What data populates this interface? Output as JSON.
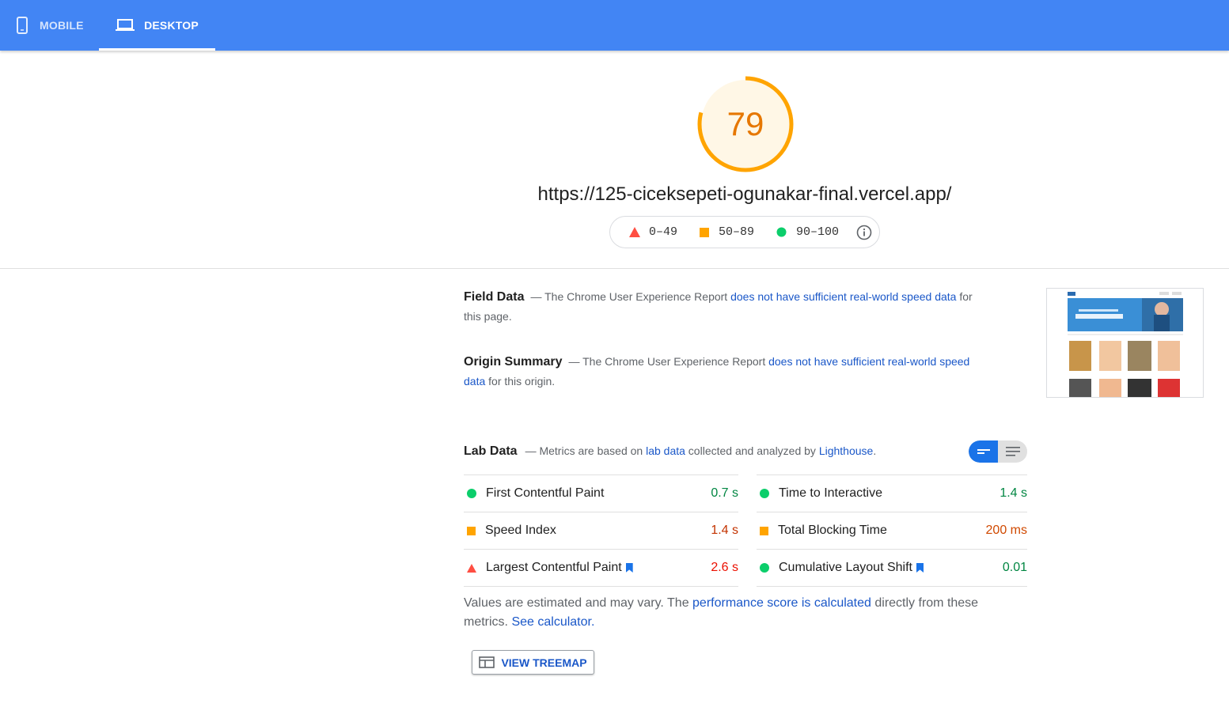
{
  "tabs": [
    {
      "label": "MOBILE",
      "icon": "phone-icon"
    },
    {
      "label": "DESKTOP",
      "icon": "laptop-icon",
      "active": true
    }
  ],
  "score": {
    "value": "79",
    "fraction": 0.79,
    "color": "#ffa400"
  },
  "url": "https://125-ciceksepeti-ogunakar-final.vercel.app/",
  "legend": {
    "fail": "0–49",
    "average": "50–89",
    "pass": "90–100"
  },
  "field_data": {
    "title": "Field Data",
    "text_before": "— The Chrome User Experience Report ",
    "link": "does not have sufficient real-world speed data",
    "text_after": " for this page."
  },
  "origin_summary": {
    "title": "Origin Summary",
    "text_before": "— The Chrome User Experience Report ",
    "link": "does not have sufficient real-world speed data",
    "text_after": " for this origin."
  },
  "lab_data": {
    "title": "Lab Data",
    "text1": "— Metrics are based on ",
    "link1": "lab data",
    "text2": " collected and analyzed by ",
    "link2": "Lighthouse",
    "text3": "."
  },
  "metrics_col1": [
    {
      "label": "First Contentful Paint",
      "value": "0.7 s",
      "status": "pass"
    },
    {
      "label": "Speed Index",
      "value": "1.4 s",
      "status": "average"
    },
    {
      "label": "Largest Contentful Paint",
      "value": "2.6 s",
      "status": "fail"
    }
  ],
  "metrics_col2": [
    {
      "label": "Time to Interactive",
      "value": "1.4 s",
      "status": "pass"
    },
    {
      "label": "Total Blocking Time",
      "value": "200 ms",
      "status": "average"
    },
    {
      "label": "Cumulative Layout Shift",
      "value": "0.01",
      "status": "pass"
    }
  ],
  "note": {
    "text1": "Values are estimated and may vary. The ",
    "link1": "performance score is calculated",
    "text2": " directly from these metrics. ",
    "link2": "See calculator."
  },
  "treemap_button": "VIEW TREEMAP",
  "colors": {
    "brand": "#4285f4",
    "pass": "#0cce6b",
    "average": "#ffa400",
    "fail": "#ff4e42",
    "link": "#1a57c8"
  }
}
